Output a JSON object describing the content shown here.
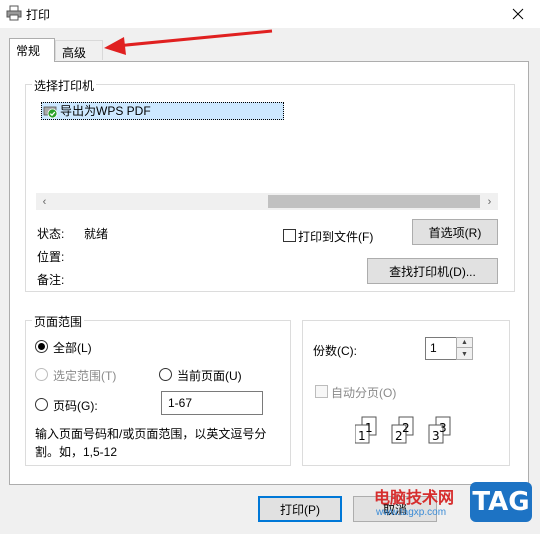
{
  "window": {
    "title": "打印"
  },
  "tabs": [
    {
      "label": "常规",
      "active": true
    },
    {
      "label": "高级",
      "active": false
    }
  ],
  "select_printer": {
    "legend": "选择打印机",
    "printers": [
      {
        "name": "导出为WPS PDF",
        "selected": true
      }
    ],
    "status_label": "状态:",
    "status_value": "就绪",
    "location_label": "位置:",
    "comment_label": "备注:",
    "print_to_file_label": "打印到文件(F)",
    "print_to_file_checked": false,
    "preferences_button": "首选项(R)",
    "find_printer_button": "查找打印机(D)..."
  },
  "page_range": {
    "legend": "页面范围",
    "all_label": "全部(L)",
    "all_checked": true,
    "selection_label": "选定范围(T)",
    "current_page_label": "当前页面(U)",
    "pages_label": "页码(G):",
    "pages_value": "1-67",
    "hint_line1": "输入页面号码和/或页面范围，以英文逗号分",
    "hint_line2": "割。如，1,5-12"
  },
  "copies": {
    "label": "份数(C):",
    "value": "1",
    "collate_label": "自动分页(O)",
    "collate_checked": false,
    "collate_disabled": true
  },
  "footer": {
    "print_button": "打印(P)",
    "cancel_button": "取消"
  },
  "watermark": {
    "brand": "电脑技术网",
    "url": "www.tagxp.com",
    "tag": "TAG"
  },
  "colors": {
    "accent": "#0078d7",
    "annotation_arrow": "#e02020",
    "selection": "#cde8ff"
  }
}
